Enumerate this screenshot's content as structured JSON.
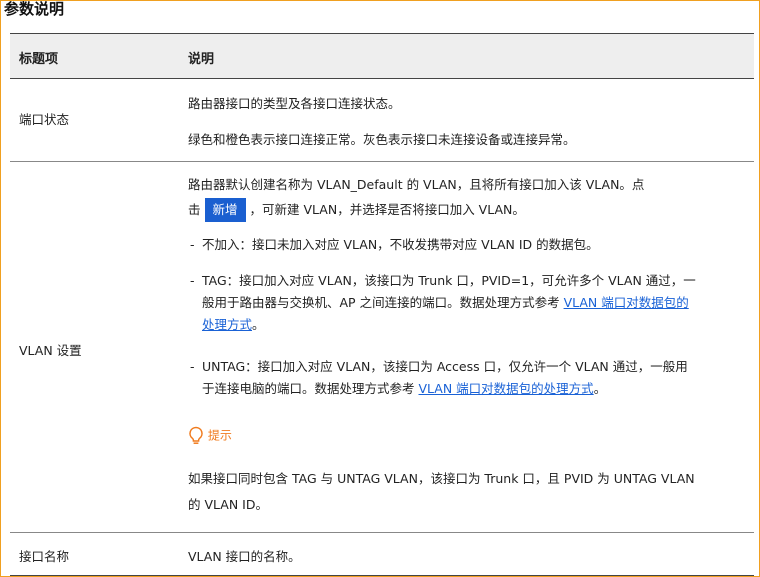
{
  "heading": "参数说明",
  "table": {
    "col1_header": "标题项",
    "col2_header": "说明",
    "row_port": {
      "label": "端口状态",
      "line1": "路由器接口的类型及各接口连接状态。",
      "line2": "绿色和橙色表示接口连接正常。灰色表示接口未连接设备或连接异常。"
    },
    "row_vlan": {
      "label": "VLAN 设置",
      "intro_part1": "路由器默认创建名称为 VLAN_Default 的 VLAN，且将所有接口加入该 VLAN。点",
      "intro_part2_prefix": "击",
      "add_button": "新增",
      "intro_part2_suffix": "，可新建 VLAN，并选择是否将接口加入 VLAN。",
      "bullet1": "不加入：接口未加入对应 VLAN，不收发携带对应 VLAN ID 的数据包。",
      "bullet2_line1": "TAG：接口加入对应 VLAN，该接口为 Trunk 口，PVID=1，可允许多个 VLAN 通过，一",
      "bullet2_line2": "般用于路由器与交换机、AP 之间连接的端口。数据处理方式参考",
      "bullet2_link_a": "VLAN 端口对数据包的",
      "bullet2_link_b": "处理方式",
      "bullet2_end": "。",
      "bullet3_line1": "UNTAG：接口加入对应 VLAN，该接口为 Access 口，仅允许一个 VLAN 通过，一般用",
      "bullet3_line2": "于连接电脑的端口。数据处理方式参考",
      "bullet3_link": "VLAN 端口对数据包的处理方式",
      "bullet3_end": "。",
      "tip_label": "提示",
      "tip_line1": "如果接口同时包含 TAG 与 UNTAG VLAN，该接口为 Trunk 口，且 PVID 为 UNTAG VLAN",
      "tip_line2": "的 VLAN ID。"
    },
    "row_name": {
      "label": "接口名称",
      "desc": "VLAN 接口的名称。"
    }
  },
  "colors": {
    "link": "#1a62d6",
    "button": "#1a5fd0",
    "tip": "#f07b1e",
    "frame": "#f0a020"
  },
  "icons": {
    "tip": "lightbulb-icon"
  }
}
